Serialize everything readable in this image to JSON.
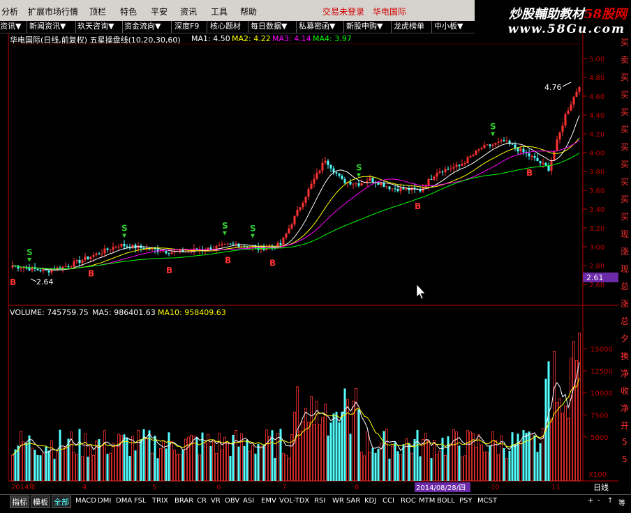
{
  "menubar": {
    "items": [
      "分析",
      "扩展市场行情",
      "顶栏",
      "特色",
      "平安",
      "资讯",
      "工具",
      "帮助"
    ],
    "status": "交易未登录",
    "stock": "华电国际"
  },
  "watermark": {
    "line1_a": "炒股輔助教材",
    "line1_b": "58股网",
    "line2": "www.58Gu.com"
  },
  "navbar": {
    "items": [
      "资讯▼",
      "新闻资讯▼",
      "玖天咨询▼",
      "资金流向▼",
      "深度F9",
      "核心题材",
      "每日数据▼",
      "私募密函▼",
      "新股申购▼",
      "龙虎榜单",
      "中小板▼"
    ]
  },
  "price_panel": {
    "title": "华电国际(日线,前复权) 五星操盘线(10,20,30,60)",
    "ma1": "MA1: 4.50",
    "ma2": "MA2: 4.22",
    "ma3": "MA3: 4.14",
    "ma4": "MA4: 3.97",
    "high_label": "4.76",
    "low_label": "2.64",
    "current_price": "2.61",
    "y_ticks": [
      "5.00",
      "4.80",
      "4.60",
      "4.40",
      "4.20",
      "4.00",
      "3.80",
      "3.60",
      "3.40",
      "3.20",
      "3.00",
      "2.80",
      "2.60"
    ],
    "colors": {
      "up": "#ff3232",
      "down": "#54ffff",
      "ma1": "#ffffff",
      "ma2": "#ffff00",
      "ma3": "#ff00ff",
      "ma4": "#00ff00",
      "axis": "#c00000"
    }
  },
  "signals": {
    "buy": "B",
    "sell": "S"
  },
  "volume_panel": {
    "vol": "VOLUME: 745759.75",
    "ma5": "MA5: 986401.63",
    "ma10": "MA10: 958409.63",
    "y_ticks": [
      "15000",
      "12500",
      "10000",
      "7500",
      "5000"
    ],
    "unit": "X100"
  },
  "x_axis": {
    "labels": [
      "2014年",
      "4",
      "5",
      "6",
      "7",
      "8",
      "10",
      "11"
    ],
    "cursor_date": "2014/08/28/四",
    "period": "日线"
  },
  "right_column": [
    "买",
    "卖",
    "买",
    "买",
    "买",
    "买",
    "买",
    "买",
    "买",
    "买",
    "买",
    "现",
    "涨",
    "现",
    "总",
    "涨",
    "总",
    "夕",
    "换",
    "净",
    "收",
    "净",
    "开",
    "5",
    "5"
  ],
  "bottombar": {
    "tabs": [
      "指标",
      "模板",
      "全部"
    ],
    "indicators": [
      "MACD",
      "DMI",
      "DMA",
      "FSL",
      "TRIX",
      "BRAR",
      "CR",
      "VR",
      "OBV",
      "ASI",
      "EMV",
      "VOL-TDX",
      "RSI",
      "WR",
      "SAR",
      "KDJ",
      "CCI",
      "ROC",
      "MTM",
      "BOLL",
      "PSY",
      "MCST"
    ],
    "controls": [
      "+",
      "-",
      "↑",
      "等"
    ]
  }
}
